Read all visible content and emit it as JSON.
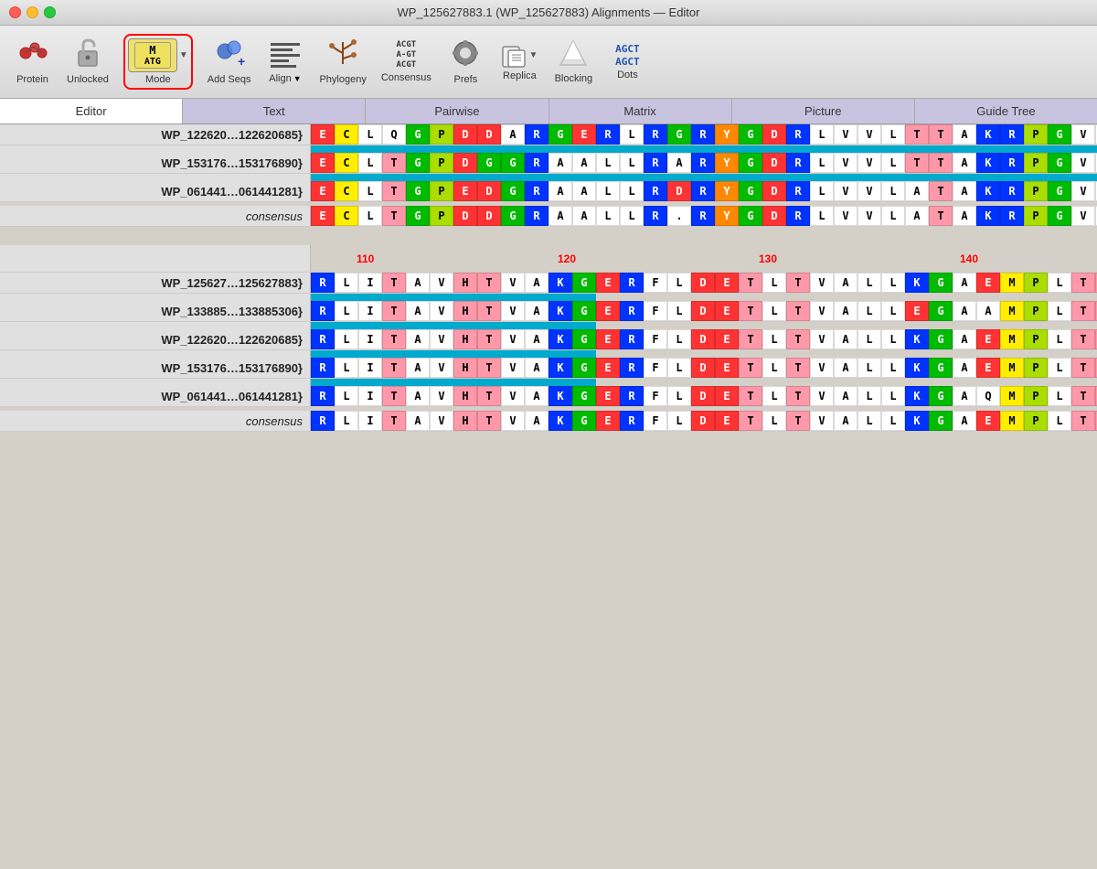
{
  "titleBar": {
    "title": "WP_125627883.1 (WP_125627883) Alignments — Editor"
  },
  "toolbar": {
    "items": [
      {
        "id": "protein",
        "label": "Protein",
        "icon": "protein"
      },
      {
        "id": "unlocked",
        "label": "Unlocked",
        "icon": "unlock"
      },
      {
        "id": "mode",
        "label": "Mode",
        "icon": "mode",
        "special": true
      },
      {
        "id": "addseqs",
        "label": "Add Seqs",
        "icon": "addseqs"
      },
      {
        "id": "align",
        "label": "Align",
        "icon": "align"
      },
      {
        "id": "phylogeny",
        "label": "Phylogeny",
        "icon": "phylogeny"
      },
      {
        "id": "consensus",
        "label": "Consensus",
        "icon": "consensus"
      },
      {
        "id": "prefs",
        "label": "Prefs",
        "icon": "prefs"
      },
      {
        "id": "replica",
        "label": "Replica",
        "icon": "replica"
      },
      {
        "id": "blocking",
        "label": "Blocking",
        "icon": "blocking"
      },
      {
        "id": "dots",
        "label": "Dots",
        "icon": "dots"
      }
    ]
  },
  "tabs": [
    {
      "id": "editor",
      "label": "Editor",
      "active": true
    },
    {
      "id": "text",
      "label": "Text"
    },
    {
      "id": "pairwise",
      "label": "Pairwise"
    },
    {
      "id": "matrix",
      "label": "Matrix"
    },
    {
      "id": "picture",
      "label": "Picture"
    },
    {
      "id": "guidetree",
      "label": "Guide Tree"
    }
  ],
  "sequences": {
    "block1": {
      "rows": [
        {
          "name": "WP_122620…122620685}",
          "cells": "ECLQGPDDARGERLRGRYGDRLVVLTTAKRPGVLRRAF"
        },
        {
          "name": "WP_153176…153176890}",
          "cells": "ECLTGPDGGRAALLRARYGDRLVVLTTAKRPGVLRRAF"
        },
        {
          "name": "WP_061441…061441281}",
          "cells": "ECLTGPEDGRAALLRDRYGDRLVVLATAKRPGVLRRAF"
        },
        {
          "name": "consensus",
          "consensus": true,
          "cells": "ECLTGPDDGRAALLR.RYGDRLVVLATAKRPGVLRRAF"
        }
      ]
    },
    "ruler": {
      "numbers": [
        {
          "label": "110",
          "position": 60
        },
        {
          "label": "120",
          "position": 280
        },
        {
          "label": "130",
          "position": 500
        },
        {
          "label": "140",
          "position": 720
        }
      ]
    },
    "block2": {
      "rows": [
        {
          "name": "WP_125627…125627883}",
          "cells": "RLITAVHTVAKGERFLDETLTVALLKGAEMPLTTRELG"
        },
        {
          "name": "WP_133885…133885306}",
          "cells": "RLITAVHTVAKGERFLDETLTVALLEGAAMPLTTRELG"
        },
        {
          "name": "WP_122620…122620685}",
          "cells": "RLITAVHTVAKGERFLDETLTVALLKGAEMPLTTRELG"
        },
        {
          "name": "WP_153176…153176890}",
          "cells": "RLITAVHTVAKGERFLDETLTVALLKGAEMPLTTRELG"
        },
        {
          "name": "WP_061441…061441281}",
          "cells": "RLITAVHTVAKGERFLDETLTVALLKGAQMPLTTRELG"
        },
        {
          "name": "consensus",
          "consensus": true,
          "cells": "RLITAVHTVAKGERFLDETLTVALLKGAEMPLTTRELG"
        }
      ]
    }
  },
  "colors": {
    "E": "red",
    "C": "yellow",
    "L": "white",
    "Q": "white",
    "G": "green",
    "P": "lime",
    "D": "red",
    "A": "white",
    "R": "blue",
    "M": "yellow",
    "T": "pink",
    "N": "white",
    "K": "blue",
    "H": "pink",
    "V": "white",
    "I": "white",
    "F": "white",
    "Y": "orange",
    "W": "white",
    "S": "white",
    ".": "white"
  }
}
